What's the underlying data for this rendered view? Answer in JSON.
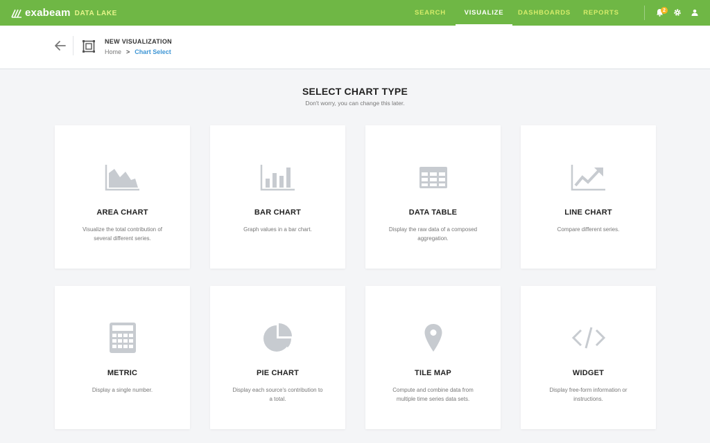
{
  "topbar": {
    "brand": "exabeam",
    "product": "DATA LAKE",
    "nav": [
      {
        "label": "SEARCH",
        "active": false
      },
      {
        "label": "VISUALIZE",
        "active": true
      },
      {
        "label": "DASHBOARDS",
        "active": false
      },
      {
        "label": "REPORTS",
        "active": false
      }
    ],
    "notification_count": "2",
    "colors": {
      "bar": "#6fb745",
      "inactive_nav": "#d6ec6a",
      "badge": "#f5b623"
    }
  },
  "header": {
    "title": "NEW VISUALIZATION",
    "breadcrumb": {
      "home": "Home",
      "separator": ">",
      "current": "Chart Select"
    }
  },
  "main": {
    "title": "SELECT CHART TYPE",
    "subtitle": "Don't worry, you can change this later.",
    "cards": [
      {
        "icon": "area-chart-icon",
        "title": "AREA CHART",
        "desc": "Visualize the total contribution of several different series."
      },
      {
        "icon": "bar-chart-icon",
        "title": "BAR CHART",
        "desc": "Graph values in a bar chart."
      },
      {
        "icon": "data-table-icon",
        "title": "DATA TABLE",
        "desc": "Display the raw data of a composed aggregation."
      },
      {
        "icon": "line-chart-icon",
        "title": "LINE CHART",
        "desc": "Compare different series."
      },
      {
        "icon": "calculator-icon",
        "title": "METRIC",
        "desc": "Display a single number."
      },
      {
        "icon": "pie-chart-icon",
        "title": "PIE CHART",
        "desc": "Display each source's contribution to a total."
      },
      {
        "icon": "map-pin-icon",
        "title": "TILE MAP",
        "desc": "Compute and combine data from multiple time series data sets."
      },
      {
        "icon": "code-icon",
        "title": "WIDGET",
        "desc": "Display free-form information or instructions."
      }
    ]
  }
}
